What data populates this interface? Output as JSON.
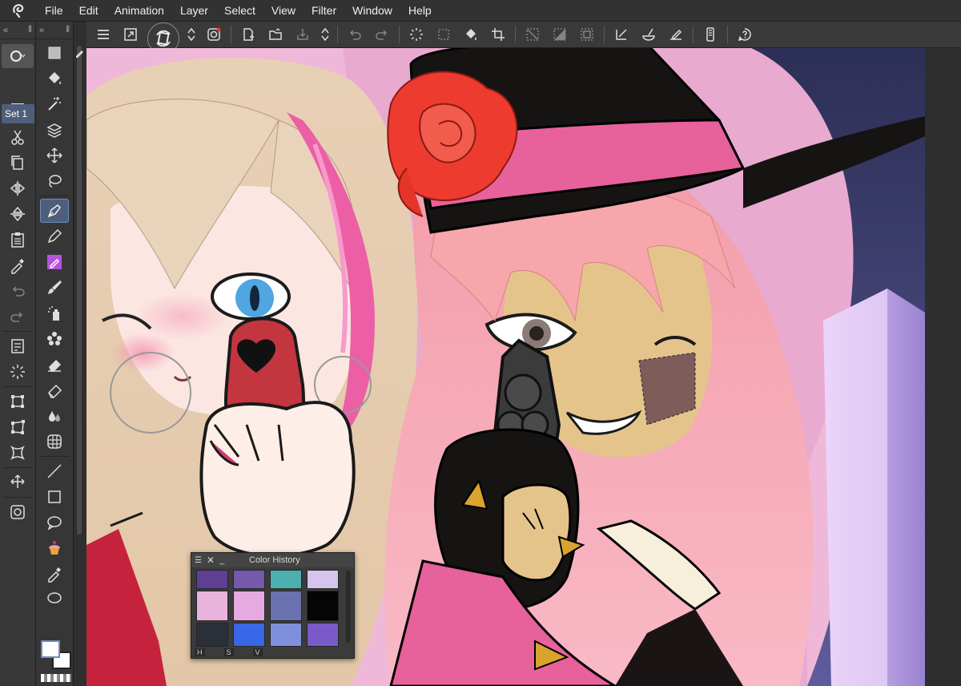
{
  "menubar": {
    "logo_icon": "clip-studio-logo-icon",
    "items": [
      {
        "label": "File"
      },
      {
        "label": "Edit"
      },
      {
        "label": "Animation"
      },
      {
        "label": "Layer"
      },
      {
        "label": "Select"
      },
      {
        "label": "View"
      },
      {
        "label": "Filter"
      },
      {
        "label": "Window"
      },
      {
        "label": "Help"
      }
    ]
  },
  "commandbar": {
    "icons": [
      "menu-icon",
      "fit-screen-icon",
      "rotate-canvas-icon",
      "updown-icon",
      "clip-studio-icon",
      "new-file-icon",
      "open-folder-icon",
      "save-icon",
      "updown-icon",
      "undo-icon",
      "redo-icon",
      "loading-icon",
      "transform-icon",
      "fill-icon",
      "crop-icon",
      "clear-selection-icon",
      "invert-selection-icon",
      "selection-border-icon",
      "ruler-icon",
      "brush-shape-icon",
      "stabilizer-icon",
      "companion-icon",
      "help-icon"
    ]
  },
  "tool_panel": {
    "set_label": "Set 1",
    "tools": [
      "select-object-icon",
      "fill-icon",
      "magic-wand-icon",
      "layers-icon",
      "move-icon",
      "lasso-icon",
      "pen-icon",
      "pencil-icon",
      "marker-icon",
      "brush-icon",
      "airbrush-icon",
      "decoration-icon",
      "eraser-icon",
      "eraser-soft-icon",
      "blend-icon",
      "grid-icon",
      "line-icon",
      "rectangle-icon",
      "speech-bubble-icon",
      "cupcake-icon",
      "eyedropper-icon",
      "ellipse-icon"
    ]
  },
  "side_strip": {
    "tools": [
      "new-icon",
      "scissors-icon",
      "copy-icon",
      "flip-horizontal-icon",
      "flip-vertical-icon",
      "paste-icon",
      "eyedropper-icon",
      "undo-icon",
      "redo-icon",
      "document-icon",
      "loading-icon",
      "transform-square-icon",
      "transform-free-icon",
      "warp-icon",
      "move-layer-icon",
      "settings-icon"
    ]
  },
  "color_history": {
    "title": "Color History",
    "swatches": [
      "#5e3f94",
      "#7658ad",
      "#4cb0b1",
      "#d5c4ee",
      "#e9b4dc",
      "#e6a9e0",
      "#6a72b0",
      "#050505",
      "#2a2f38",
      "#3a66e8",
      "#7f8fdc",
      "#7a5ac8"
    ],
    "footer": [
      "H",
      "S",
      "V"
    ]
  },
  "colors": {
    "foreground": "#ffffff",
    "background": "#ffffff",
    "accent": "#4d5f7a"
  }
}
